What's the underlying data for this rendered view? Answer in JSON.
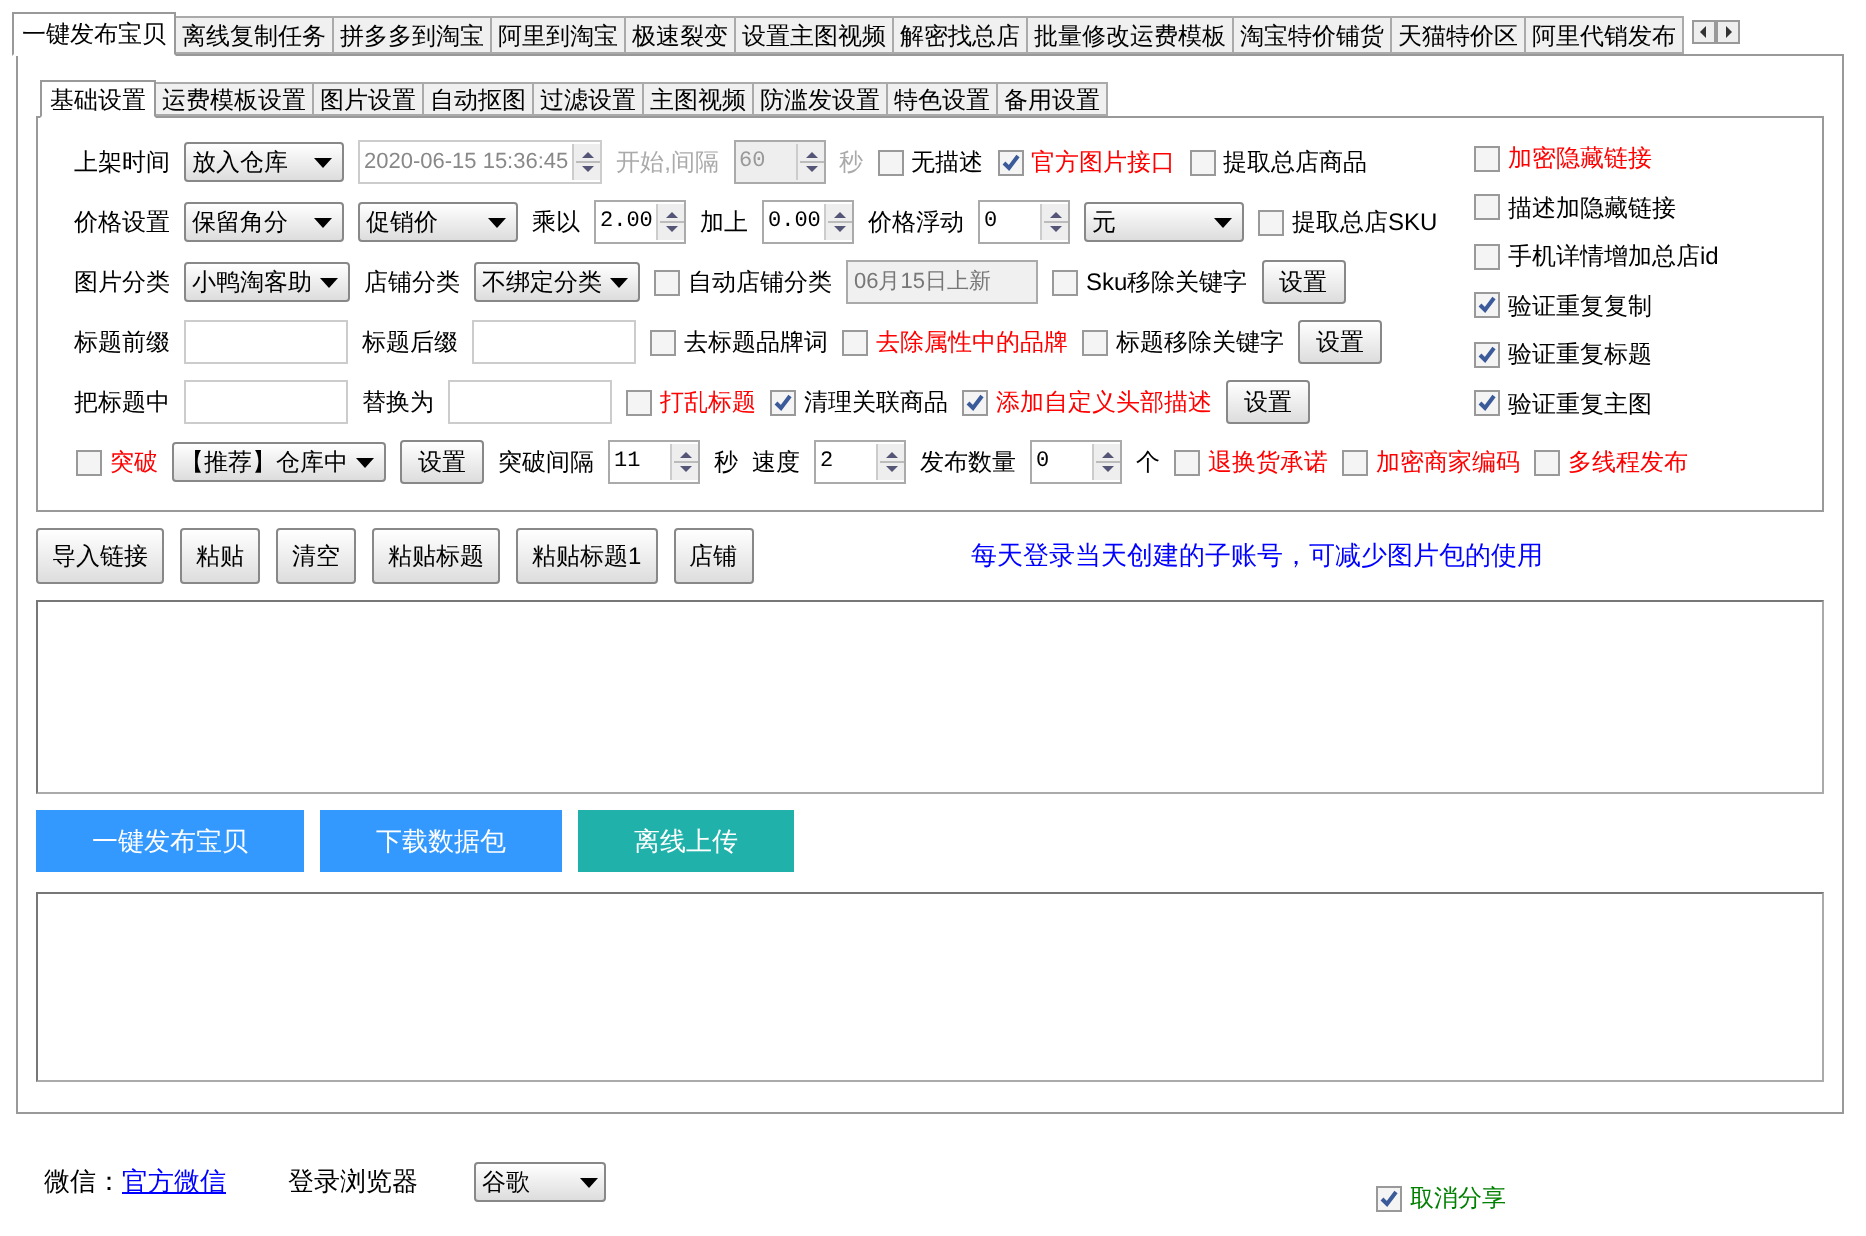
{
  "tabs": [
    {
      "label": "一键发布宝贝",
      "selected": true
    },
    {
      "label": "离线复制任务",
      "selected": false
    },
    {
      "label": "拼多多到淘宝",
      "selected": false
    },
    {
      "label": "阿里到淘宝",
      "selected": false
    },
    {
      "label": "极速裂变",
      "selected": false
    },
    {
      "label": "设置主图视频",
      "selected": false
    },
    {
      "label": "解密找总店",
      "selected": false
    },
    {
      "label": "批量修改运费模板",
      "selected": false
    },
    {
      "label": "淘宝特价铺货",
      "selected": false
    },
    {
      "label": "天猫特价区",
      "selected": false
    },
    {
      "label": "阿里代销发布",
      "selected": false
    }
  ],
  "subtabs": [
    {
      "label": "基础设置",
      "selected": true
    },
    {
      "label": "运费模板设置",
      "selected": false
    },
    {
      "label": "图片设置",
      "selected": false
    },
    {
      "label": "自动抠图",
      "selected": false
    },
    {
      "label": "过滤设置",
      "selected": false
    },
    {
      "label": "主图视频",
      "selected": false
    },
    {
      "label": "防滥发设置",
      "selected": false
    },
    {
      "label": "特色设置",
      "selected": false
    },
    {
      "label": "备用设置",
      "selected": false
    }
  ],
  "settings": {
    "rows": [
      {
        "items": [
          {
            "kind": "label",
            "text": "上架时间",
            "disabled": false
          },
          {
            "kind": "select",
            "value": "放入仓库"
          },
          {
            "kind": "date",
            "value": "2020-06-15 15:36:45"
          },
          {
            "kind": "label",
            "text": "开始,间隔",
            "disabled": true
          },
          {
            "kind": "spin",
            "value": "60",
            "disabled": true
          },
          {
            "kind": "label",
            "text": "秒",
            "disabled": true
          },
          {
            "kind": "check",
            "label": "无描述",
            "checked": false,
            "color": "#000000"
          },
          {
            "kind": "check",
            "label": "官方图片接口",
            "checked": true,
            "color": "#ff0000"
          },
          {
            "kind": "check",
            "label": "提取总店商品",
            "checked": false,
            "color": "#000000"
          }
        ]
      },
      {
        "items": [
          {
            "kind": "label",
            "text": "价格设置",
            "disabled": false
          },
          {
            "kind": "select",
            "value": "保留角分"
          },
          {
            "kind": "select",
            "value": "促销价"
          },
          {
            "kind": "label",
            "text": "乘以",
            "disabled": false
          },
          {
            "kind": "spin",
            "value": "2.00",
            "disabled": false
          },
          {
            "kind": "label",
            "text": "加上",
            "disabled": false
          },
          {
            "kind": "spin",
            "value": "0.00",
            "disabled": false
          },
          {
            "kind": "label",
            "text": "价格浮动",
            "disabled": false
          },
          {
            "kind": "spin",
            "value": "0",
            "disabled": false
          },
          {
            "kind": "select",
            "value": "元"
          },
          {
            "kind": "check",
            "label": "提取总店SKU",
            "checked": false,
            "color": "#000000"
          }
        ]
      },
      {
        "items": [
          {
            "kind": "label",
            "text": "图片分类",
            "disabled": false
          },
          {
            "kind": "select",
            "value": "小鸭淘客助"
          },
          {
            "kind": "label",
            "text": "店铺分类",
            "disabled": false
          },
          {
            "kind": "select",
            "value": "不绑定分类"
          },
          {
            "kind": "check",
            "label": "自动店铺分类",
            "checked": false,
            "color": "#000000"
          },
          {
            "kind": "readonly",
            "value": "06月15日上新"
          },
          {
            "kind": "check",
            "label": "Sku移除关键字",
            "checked": false,
            "color": "#000000"
          },
          {
            "kind": "button",
            "label": "设置"
          }
        ]
      },
      {
        "items": [
          {
            "kind": "label",
            "text": "标题前缀",
            "disabled": false
          },
          {
            "kind": "input"
          },
          {
            "kind": "label",
            "text": "标题后缀",
            "disabled": false
          },
          {
            "kind": "input"
          },
          {
            "kind": "check",
            "label": "去标题品牌词",
            "checked": false,
            "color": "#000000"
          },
          {
            "kind": "check",
            "label": "去除属性中的品牌",
            "checked": false,
            "color": "#ff0000"
          },
          {
            "kind": "check",
            "label": "标题移除关键字",
            "checked": false,
            "color": "#000000"
          },
          {
            "kind": "button",
            "label": "设置"
          }
        ]
      },
      {
        "items": [
          {
            "kind": "label",
            "text": "把标题中",
            "disabled": false
          },
          {
            "kind": "input"
          },
          {
            "kind": "label",
            "text": "替换为",
            "disabled": false
          },
          {
            "kind": "input"
          },
          {
            "kind": "check",
            "label": "打乱标题",
            "checked": false,
            "color": "#ff0000"
          },
          {
            "kind": "check",
            "label": "清理关联商品",
            "checked": true,
            "color": "#000000"
          },
          {
            "kind": "check",
            "label": "添加自定义头部描述",
            "checked": true,
            "color": "#ff0000"
          },
          {
            "kind": "button",
            "label": "设置"
          }
        ]
      }
    ],
    "side": [
      {
        "label": "加密隐藏链接",
        "checked": false,
        "color": "#ff0000"
      },
      {
        "label": "描述加隐藏链接",
        "checked": false,
        "color": "#000000"
      },
      {
        "label": "手机详情增加总店id",
        "checked": false,
        "color": "#000000"
      },
      {
        "label": "验证重复复制",
        "checked": true,
        "color": "#000000"
      },
      {
        "label": "验证重复标题",
        "checked": true,
        "color": "#000000"
      },
      {
        "label": "验证重复主图",
        "checked": true,
        "color": "#000000"
      }
    ],
    "bottom": [
      {
        "kind": "check",
        "label": "突破",
        "checked": false,
        "color": "#ff0000"
      },
      {
        "kind": "select",
        "value": "【推荐】仓库中"
      },
      {
        "kind": "button",
        "label": "设置"
      },
      {
        "kind": "label",
        "text": "突破间隔",
        "disabled": false
      },
      {
        "kind": "spin",
        "value": "11",
        "disabled": false
      },
      {
        "kind": "label",
        "text": "秒",
        "disabled": false
      },
      {
        "kind": "label",
        "text": "速度",
        "disabled": false
      },
      {
        "kind": "spin",
        "value": "2",
        "disabled": false
      },
      {
        "kind": "label",
        "text": "发布数量",
        "disabled": false
      },
      {
        "kind": "spin",
        "value": "0",
        "disabled": false
      },
      {
        "kind": "label",
        "text": "个",
        "disabled": false
      },
      {
        "kind": "check",
        "label": "退换货承诺",
        "checked": false,
        "color": "#ff0000"
      },
      {
        "kind": "check",
        "label": "加密商家编码",
        "checked": false,
        "color": "#ff0000"
      },
      {
        "kind": "check",
        "label": "多线程发布",
        "checked": false,
        "color": "#ff0000"
      }
    ]
  },
  "toolbar": [
    "导入链接",
    "粘贴",
    "清空",
    "粘贴标题",
    "粘贴标题1",
    "店铺"
  ],
  "notice": "每天登录当天创建的子账号，可减少图片包的使用",
  "actions": [
    {
      "label": "一键发布宝贝",
      "color": "#3399ff"
    },
    {
      "label": "下载数据包",
      "color": "#3399ff"
    },
    {
      "label": "离线上传",
      "color": "#20b2aa"
    }
  ],
  "footer": {
    "wechat_label": "微信：",
    "wechat_link": "官方微信",
    "browser_label": "登录浏览器",
    "browser": "谷歌",
    "share": {
      "label": "取消分享",
      "checked": true
    }
  }
}
